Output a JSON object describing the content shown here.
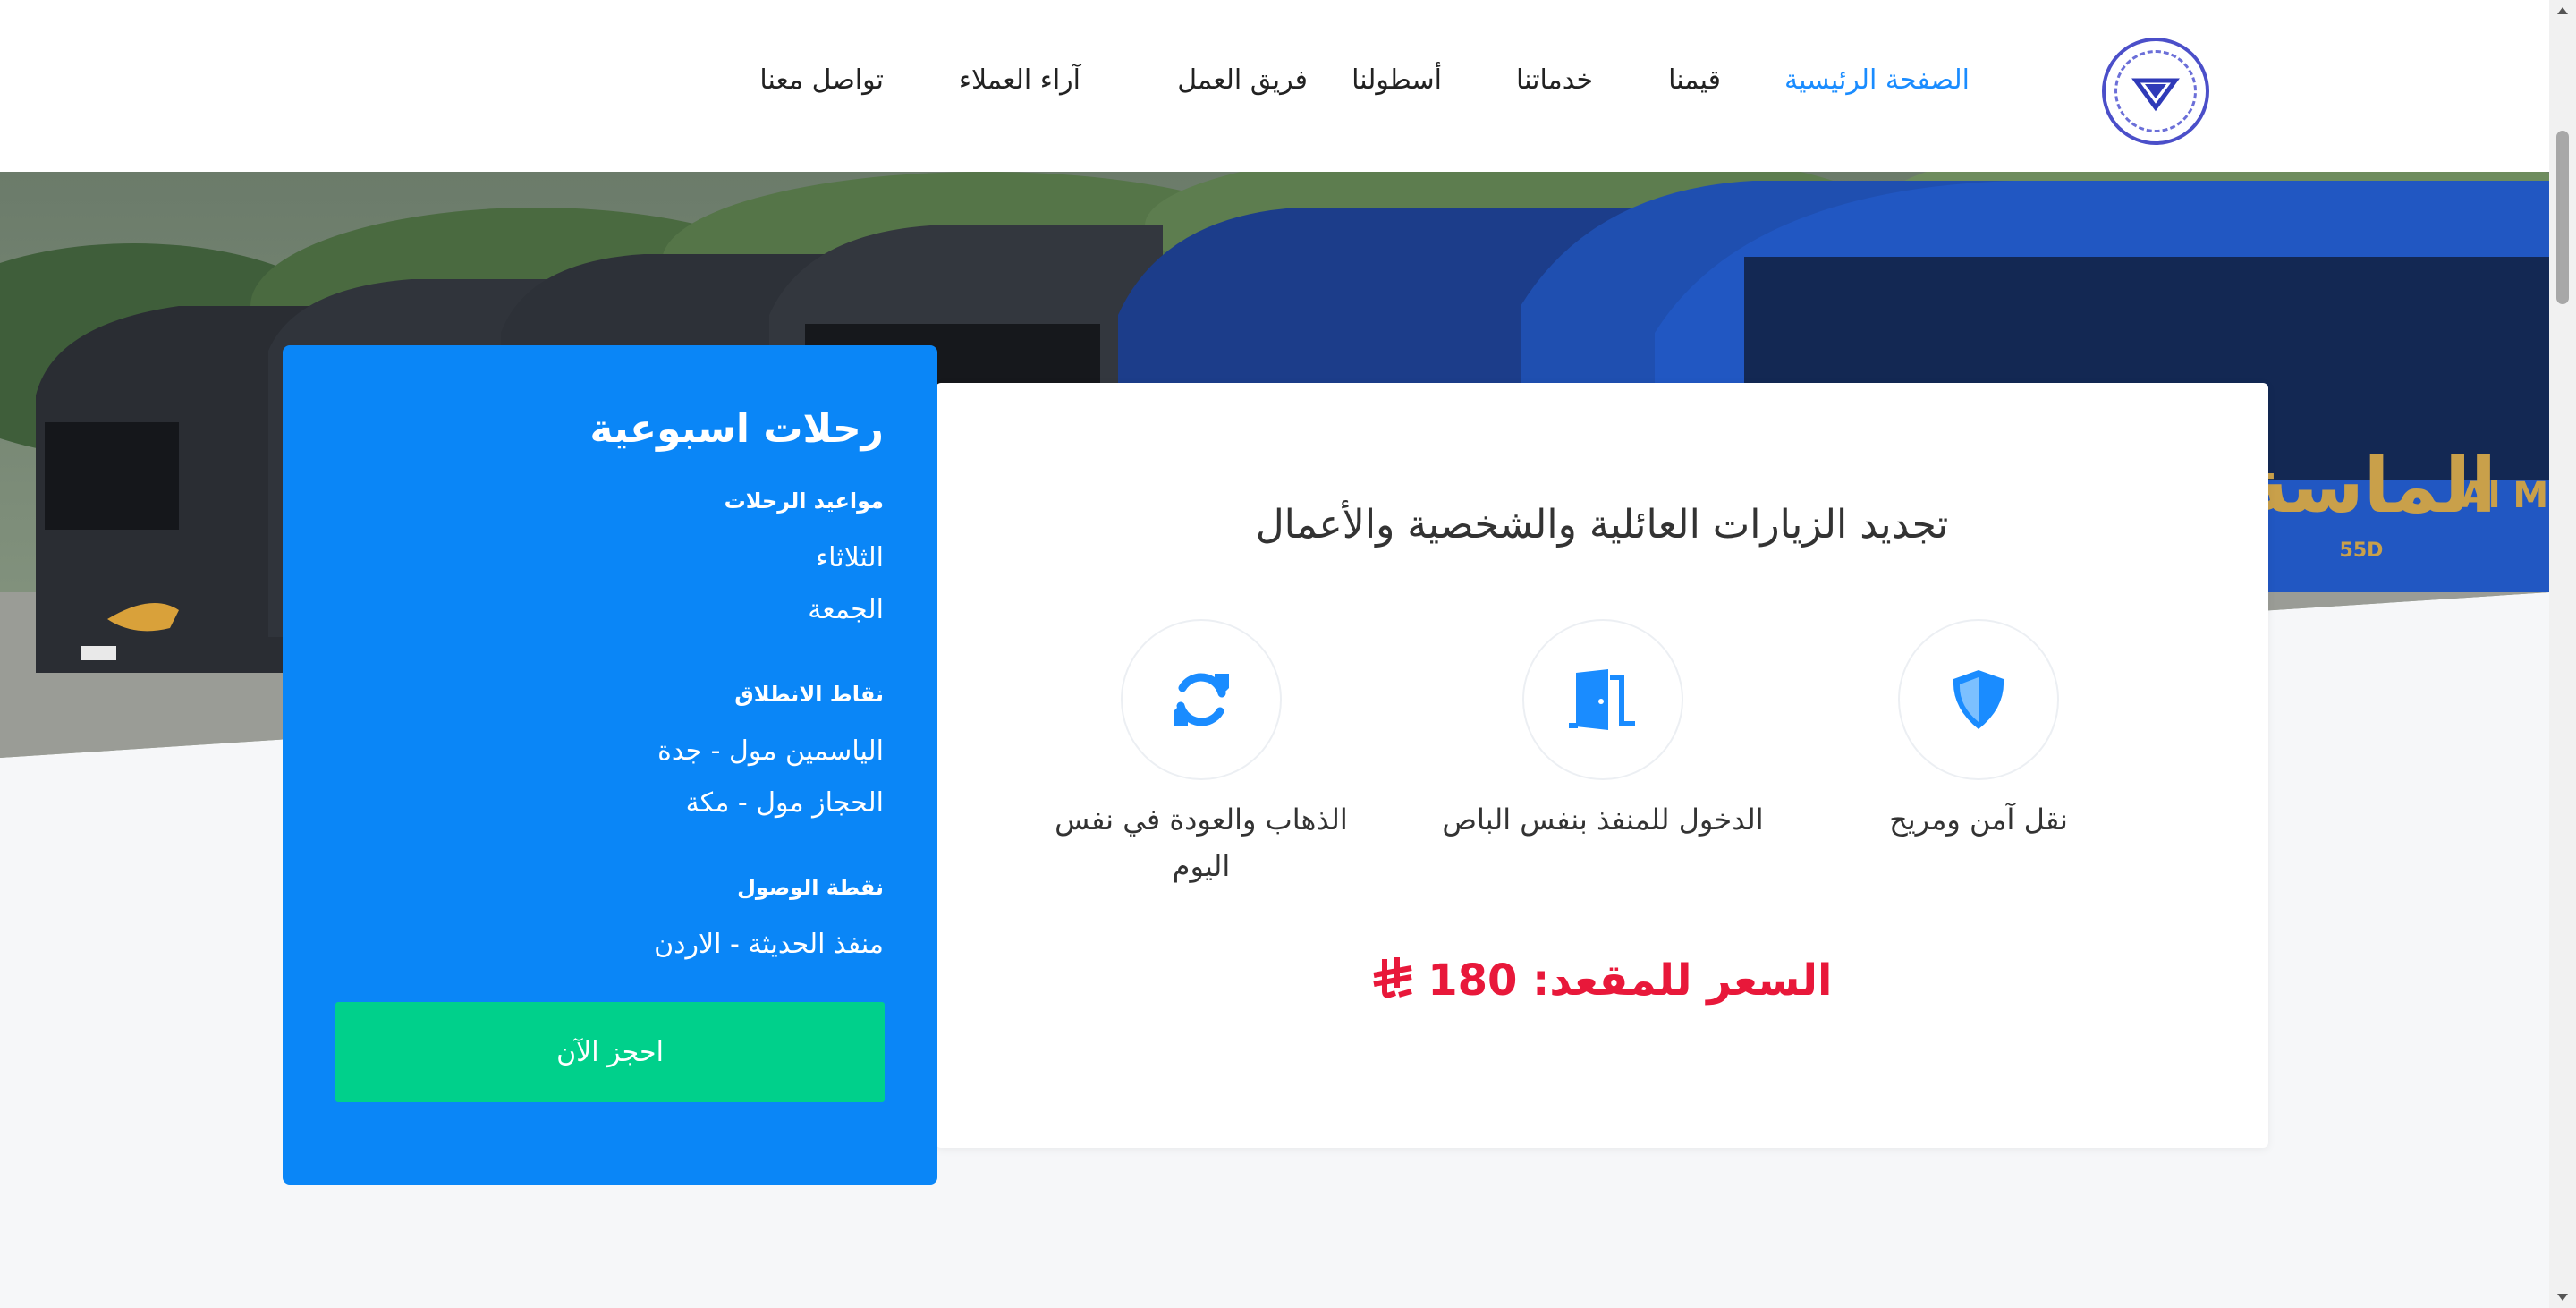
{
  "nav": {
    "items": [
      {
        "label": "الصفحة الرئيسية",
        "active": true
      },
      {
        "label": "قيمنا"
      },
      {
        "label": "خدماتنا"
      },
      {
        "label": "أسطولنا"
      },
      {
        "label": "فريق العمل"
      },
      {
        "label": "آراء العملاء"
      },
      {
        "label": "تواصل معنا"
      }
    ],
    "logo_icon": "diamond-logo-icon"
  },
  "hero": {
    "bus_brand": "الماسة",
    "bus_brand_latin": "Al M",
    "bus_code": "55D"
  },
  "card": {
    "title": "تجديد الزيارات العائلية والشخصية والأعمال",
    "features": [
      {
        "icon": "shield-icon",
        "label": "نقل آمن ومريح"
      },
      {
        "icon": "door-icon",
        "label": "الدخول للمنفذ بنفس الباص"
      },
      {
        "icon": "sync-icon",
        "label": "الذهاب والعودة في نفس اليوم"
      }
    ],
    "price_label": "السعر للمقعد:",
    "price_value": "180",
    "currency_icon": "riyal-icon"
  },
  "panel": {
    "title": "رحلات اسبوعية",
    "schedule_label": "مواعيد الرحلات",
    "days": [
      "الثلاثاء",
      "الجمعة"
    ],
    "departure_label": "نقاط الانطلاق",
    "departures": [
      "الياسمين مول - جدة",
      "الحجاز مول - مكة"
    ],
    "arrival_label": "نقطة الوصول",
    "arrival": "منفذ الحديثة - الاردن",
    "book_button": "احجز الآن"
  },
  "colors": {
    "accent": "#1a8cff",
    "panel": "#0a86f7",
    "book_button": "#00d08b",
    "price": "#e8183a"
  }
}
